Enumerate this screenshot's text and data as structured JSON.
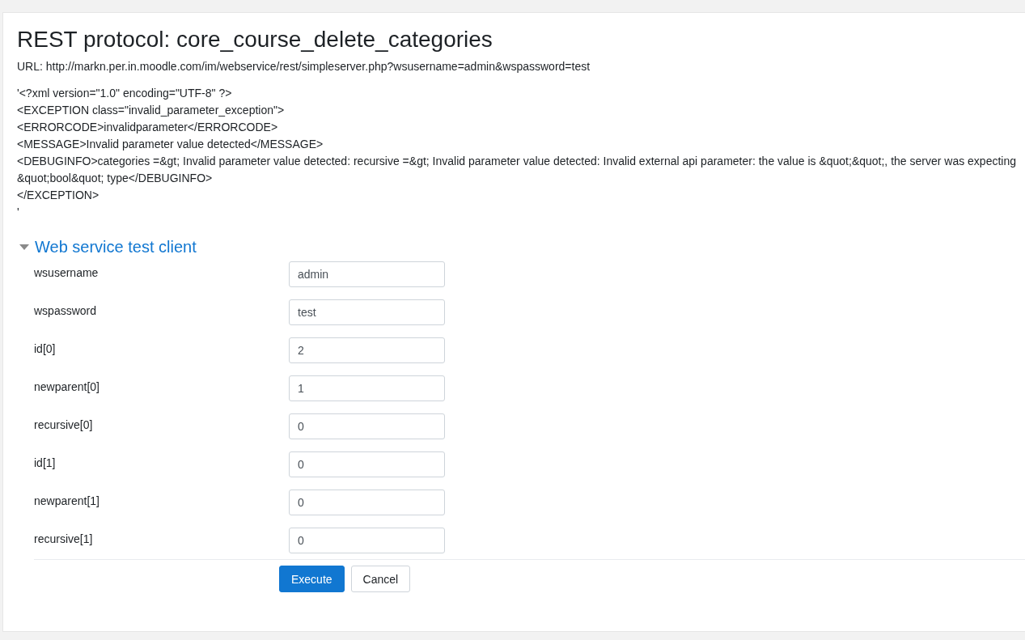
{
  "page": {
    "title": "REST protocol: core_course_delete_categories",
    "url": "URL: http://markn.per.in.moodle.com/im/webservice/rest/simpleserver.php?wsusername=admin&wspassword=test"
  },
  "response_lines": [
    "'<?xml version=\"1.0\" encoding=\"UTF-8\" ?>",
    "<EXCEPTION class=\"invalid_parameter_exception\">",
    "<ERRORCODE>invalidparameter</ERRORCODE>",
    "<MESSAGE>Invalid parameter value detected</MESSAGE>",
    "<DEBUGINFO>categories =&gt; Invalid parameter value detected: recursive =&gt; Invalid parameter value detected: Invalid external api parameter: the value is &quot;&quot;, the server was expecting &quot;bool&quot; type</DEBUGINFO>",
    "</EXCEPTION>",
    "'"
  ],
  "section": {
    "title": "Web service test client",
    "expanded": true
  },
  "fields": [
    {
      "label": "wsusername",
      "value": "admin"
    },
    {
      "label": "wspassword",
      "value": "test"
    },
    {
      "label": "id[0]",
      "value": "2"
    },
    {
      "label": "newparent[0]",
      "value": "1"
    },
    {
      "label": "recursive[0]",
      "value": "0"
    },
    {
      "label": "id[1]",
      "value": "0"
    },
    {
      "label": "newparent[1]",
      "value": "0"
    },
    {
      "label": "recursive[1]",
      "value": "0"
    }
  ],
  "buttons": [
    {
      "label": "Execute",
      "kind": "primary"
    },
    {
      "label": "Cancel",
      "kind": "secondary"
    }
  ]
}
